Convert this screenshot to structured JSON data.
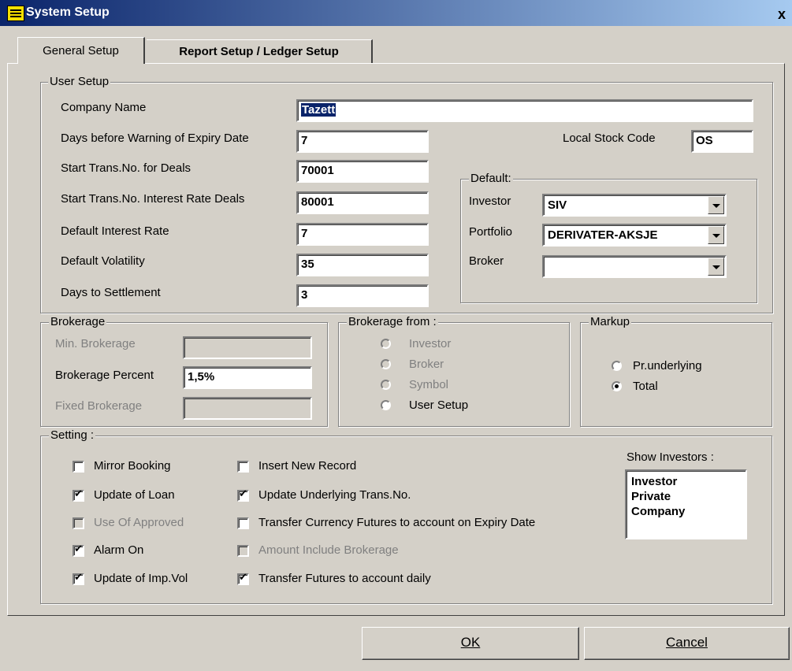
{
  "window": {
    "title": "System Setup",
    "close": "x"
  },
  "tabs": [
    {
      "label": "General Setup",
      "active": true
    },
    {
      "label": "Report Setup / Ledger Setup",
      "active": false
    }
  ],
  "user_setup": {
    "legend": "User Setup",
    "company_name_label": "Company Name",
    "company_name": "Tazett",
    "days_warning_label": "Days before Warning of Expiry Date",
    "days_warning": "7",
    "start_trans_deals_label": "Start Trans.No. for Deals",
    "start_trans_deals": "70001",
    "start_trans_interest_label": "Start Trans.No. Interest Rate Deals",
    "start_trans_interest": "80001",
    "default_interest_label": "Default Interest Rate",
    "default_interest": "7",
    "default_volatility_label": "Default Volatility",
    "default_volatility": "35",
    "days_settlement_label": "Days to Settlement",
    "days_settlement": "3",
    "local_stock_code_label": "Local Stock Code",
    "local_stock_code": "OS"
  },
  "default": {
    "legend": "Default:",
    "investor_label": "Investor",
    "investor": "SIV",
    "portfolio_label": "Portfolio",
    "portfolio": "DERIVATER-AKSJE",
    "broker_label": "Broker",
    "broker": ""
  },
  "brokerage": {
    "legend": "Brokerage",
    "min_label": "Min. Brokerage",
    "min": "",
    "percent_label": "Brokerage Percent",
    "percent": "1,5%",
    "fixed_label": "Fixed Brokerage",
    "fixed": ""
  },
  "brokerage_from": {
    "legend": "Brokerage from :",
    "options": [
      "Investor",
      "Broker",
      "Symbol",
      "User Setup"
    ],
    "selected": "none"
  },
  "markup": {
    "legend": "Markup",
    "options": [
      "Pr.underlying",
      "Total"
    ],
    "selected": "Total"
  },
  "setting": {
    "legend": "Setting :",
    "left": [
      {
        "label": "Mirror Booking",
        "checked": false,
        "enabled": true
      },
      {
        "label": "Update of Loan",
        "checked": true,
        "enabled": true
      },
      {
        "label": "Use Of Approved",
        "checked": false,
        "enabled": false
      },
      {
        "label": "Alarm On",
        "checked": true,
        "enabled": true
      },
      {
        "label": "Update of Imp.Vol",
        "checked": true,
        "enabled": true
      }
    ],
    "right": [
      {
        "label": "Insert New Record",
        "checked": false,
        "enabled": true
      },
      {
        "label": "Update Underlying Trans.No.",
        "checked": true,
        "enabled": true
      },
      {
        "label": "Transfer Currency Futures to account on Expiry Date",
        "checked": false,
        "enabled": true
      },
      {
        "label": "Amount Include Brokerage",
        "checked": false,
        "enabled": false
      },
      {
        "label": "Transfer Futures to account daily",
        "checked": true,
        "enabled": true
      }
    ],
    "show_investors_label": "Show Investors :",
    "show_investors": [
      "Investor",
      "Private",
      "Company"
    ]
  },
  "buttons": {
    "ok": "OK",
    "cancel": "Cancel"
  }
}
